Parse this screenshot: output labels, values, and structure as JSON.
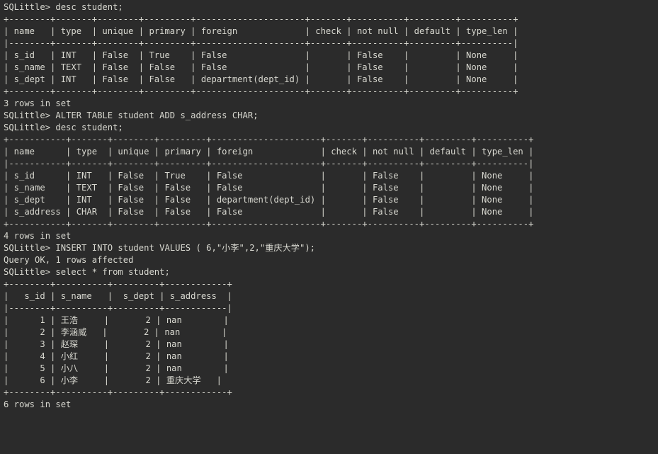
{
  "terminal": {
    "prompt": "SQLittle>",
    "background_color": "#2b2b2b",
    "foreground_color": "#d8d8d0",
    "title": "SQLittle Terminal Session"
  },
  "session": {
    "commands": [
      "desc student;",
      "ALTER TABLE student ADD s_address CHAR;",
      "desc student;",
      "INSERT INTO student VALUES ( 6,\"小李\",2,\"重庆大学\");",
      "select * from student;"
    ],
    "status_messages": [
      "3 rows in set",
      "4 rows in set",
      "Query OK, 1 rows affected",
      "6 rows in set"
    ]
  },
  "desc_table_1": {
    "type": "table",
    "columns": [
      "name",
      "type",
      "unique",
      "primary",
      "foreign",
      "check",
      "not null",
      "default",
      "type_len"
    ],
    "rows": [
      [
        "s_id",
        "INT",
        "False",
        "True",
        "False",
        "",
        "False",
        "",
        "None"
      ],
      [
        "s_name",
        "TEXT",
        "False",
        "False",
        "False",
        "",
        "False",
        "",
        "None"
      ],
      [
        "s_dept",
        "INT",
        "False",
        "False",
        "department(dept_id)",
        "",
        "False",
        "",
        "None"
      ]
    ],
    "footer": "3 rows in set"
  },
  "desc_table_2": {
    "type": "table",
    "columns": [
      "name",
      "type",
      "unique",
      "primary",
      "foreign",
      "check",
      "not null",
      "default",
      "type_len"
    ],
    "rows": [
      [
        "s_id",
        "INT",
        "False",
        "True",
        "False",
        "",
        "False",
        "",
        "None"
      ],
      [
        "s_name",
        "TEXT",
        "False",
        "False",
        "False",
        "",
        "False",
        "",
        "None"
      ],
      [
        "s_dept",
        "INT",
        "False",
        "False",
        "department(dept_id)",
        "",
        "False",
        "",
        "None"
      ],
      [
        "s_address",
        "CHAR",
        "False",
        "False",
        "False",
        "",
        "False",
        "",
        "None"
      ]
    ],
    "footer": "4 rows in set"
  },
  "select_table": {
    "type": "table",
    "columns": [
      "s_id",
      "s_name",
      "s_dept",
      "s_address"
    ],
    "rows": [
      [
        "1",
        "王浩",
        "2",
        "nan"
      ],
      [
        "2",
        "李涵威",
        "2",
        "nan"
      ],
      [
        "3",
        "赵琛",
        "2",
        "nan"
      ],
      [
        "4",
        "小红",
        "2",
        "nan"
      ],
      [
        "5",
        "小八",
        "2",
        "nan"
      ],
      [
        "6",
        "小李",
        "2",
        "重庆大学"
      ]
    ],
    "footer": "6 rows in set"
  },
  "lines": [
    "SQLittle> desc student;",
    "+--------+-------+--------+---------+---------------------+-------+----------+---------+----------+",
    "| name   | type  | unique | primary | foreign             | check | not null | default | type_len |",
    "|--------+-------+--------+---------+---------------------+-------+----------+---------+----------|",
    "| s_id   | INT   | False  | True    | False               |       | False    |         | None     |",
    "| s_name | TEXT  | False  | False   | False               |       | False    |         | None     |",
    "| s_dept | INT   | False  | False   | department(dept_id) |       | False    |         | None     |",
    "+--------+-------+--------+---------+---------------------+-------+----------+---------+----------+",
    "3 rows in set",
    "",
    "SQLittle> ALTER TABLE student ADD s_address CHAR;",
    "SQLittle> desc student;",
    "+-----------+-------+--------+---------+---------------------+-------+----------+---------+----------+",
    "| name      | type  | unique | primary | foreign             | check | not null | default | type_len |",
    "|-----------+-------+--------+---------+---------------------+-------+----------+---------+----------|",
    "| s_id      | INT   | False  | True    | False               |       | False    |         | None     |",
    "| s_name    | TEXT  | False  | False   | False               |       | False    |         | None     |",
    "| s_dept    | INT   | False  | False   | department(dept_id) |       | False    |         | None     |",
    "| s_address | CHAR  | False  | False   | False               |       | False    |         | None     |",
    "+-----------+-------+--------+---------+---------------------+-------+----------+---------+----------+",
    "4 rows in set",
    "",
    "SQLittle> INSERT INTO student VALUES ( 6,\"小李\",2,\"重庆大学\");",
    "Query OK, 1 rows affected",
    "",
    "SQLittle> select * from student;",
    "+--------+----------+---------+------------+",
    "|   s_id | s_name   |  s_dept | s_address  |",
    "|--------+----------+---------+------------|",
    "|      1 | 王浩     |       2 | nan        |",
    "|      2 | 李涵威   |       2 | nan        |",
    "|      3 | 赵琛     |       2 | nan        |",
    "|      4 | 小红     |       2 | nan        |",
    "|      5 | 小八     |       2 | nan        |",
    "|      6 | 小李     |       2 | 重庆大学   |",
    "+--------+----------+---------+------------+",
    "6 rows in set"
  ]
}
